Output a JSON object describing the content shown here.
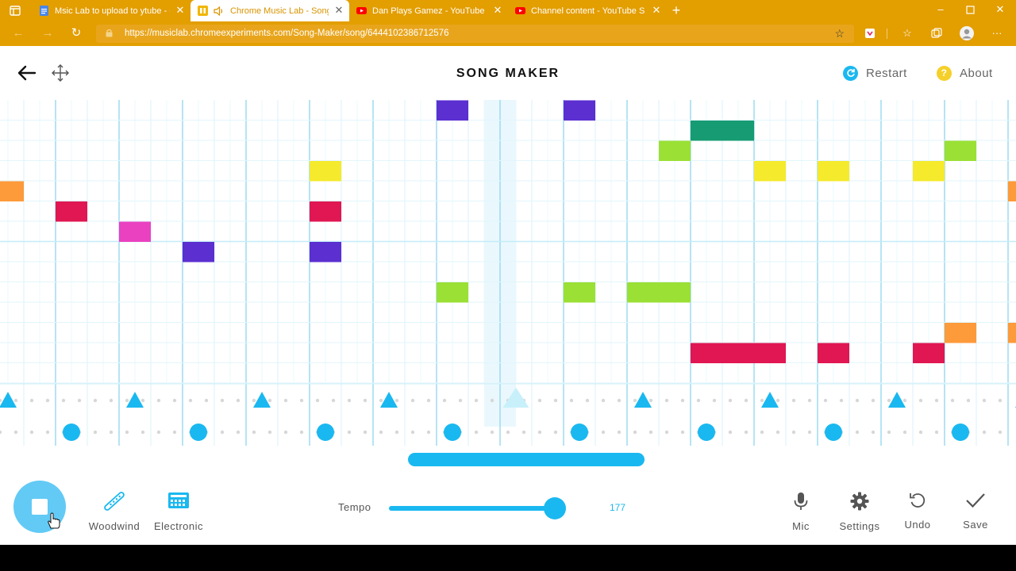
{
  "browser": {
    "tabs": [
      {
        "title": "Msic Lab to upload to ytube - Go",
        "icon": "google-docs-icon",
        "active": false
      },
      {
        "title": "Chrome Music Lab - Song M",
        "icon": "music-lab-icon",
        "active": true,
        "audio": true
      },
      {
        "title": "Dan Plays Gamez - YouTube",
        "icon": "youtube-icon",
        "active": false
      },
      {
        "title": "Channel content - YouTube Studi",
        "icon": "youtube-icon",
        "active": false
      }
    ],
    "url": "https://musiclab.chromeexperiments.com/Song-Maker/song/6444102386712576",
    "theme_color": "#e39e00"
  },
  "app": {
    "title": "SONG MAKER",
    "restart_label": "Restart",
    "about_label": "About",
    "about_icon_text": "?"
  },
  "grid": {
    "columns": 32,
    "melody_rows": 14,
    "highlight_column": 16,
    "colors": {
      "purple": "#5b2fd0",
      "teal": "#169b72",
      "lime": "#9be035",
      "yellow": "#f5ea2c",
      "orange": "#fd9a3a",
      "crimson": "#e01752",
      "magenta": "#ea41c0",
      "rhythm_blue": "#1ab8f0"
    },
    "notes": [
      {
        "row": 1,
        "col": 14,
        "color": "purple"
      },
      {
        "row": 1,
        "col": 18,
        "color": "purple"
      },
      {
        "row": 2,
        "col": 22,
        "color": "teal"
      },
      {
        "row": 2,
        "col": 23,
        "color": "teal"
      },
      {
        "row": 3,
        "col": 21,
        "color": "lime"
      },
      {
        "row": 3,
        "col": 30,
        "color": "lime"
      },
      {
        "row": 4,
        "col": 10,
        "color": "yellow"
      },
      {
        "row": 4,
        "col": 24,
        "color": "yellow"
      },
      {
        "row": 4,
        "col": 26,
        "color": "yellow"
      },
      {
        "row": 4,
        "col": 29,
        "color": "yellow"
      },
      {
        "row": 5,
        "col": 0,
        "color": "orange"
      },
      {
        "row": 5,
        "col": 32,
        "color": "orange"
      },
      {
        "row": 6,
        "col": 2,
        "color": "crimson"
      },
      {
        "row": 6,
        "col": 10,
        "color": "crimson"
      },
      {
        "row": 7,
        "col": 4,
        "color": "magenta"
      },
      {
        "row": 8,
        "col": 6,
        "color": "purple"
      },
      {
        "row": 8,
        "col": 10,
        "color": "purple"
      },
      {
        "row": 10,
        "col": 14,
        "color": "lime"
      },
      {
        "row": 10,
        "col": 18,
        "color": "lime"
      },
      {
        "row": 10,
        "col": 20,
        "color": "lime"
      },
      {
        "row": 10,
        "col": 21,
        "color": "lime"
      },
      {
        "row": 12,
        "col": 30,
        "color": "orange"
      },
      {
        "row": 12,
        "col": 32,
        "color": "orange"
      },
      {
        "row": 13,
        "col": 22,
        "color": "crimson"
      },
      {
        "row": 13,
        "col": 23,
        "color": "crimson"
      },
      {
        "row": 13,
        "col": 24,
        "color": "crimson"
      },
      {
        "row": 13,
        "col": 26,
        "color": "crimson"
      },
      {
        "row": 13,
        "col": 29,
        "color": "crimson"
      }
    ],
    "triangles": [
      0,
      4,
      8,
      12,
      16,
      20,
      24,
      28,
      32
    ],
    "circles": [
      2,
      6,
      10,
      14,
      18,
      22,
      26,
      30
    ]
  },
  "controls": {
    "play_state": "playing",
    "instrument_melody": "Woodwind",
    "instrument_rhythm": "Electronic",
    "tempo_label": "Tempo",
    "tempo_value": "177",
    "tempo_fraction": 0.95,
    "mic_label": "Mic",
    "settings_label": "Settings",
    "undo_label": "Undo",
    "save_label": "Save"
  }
}
